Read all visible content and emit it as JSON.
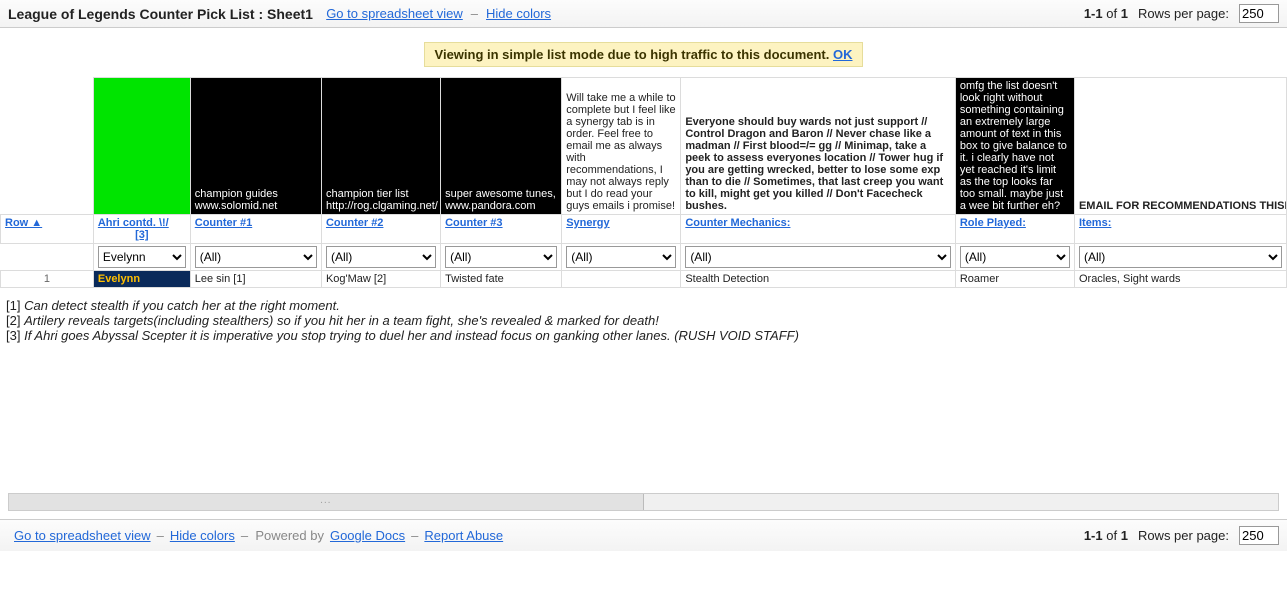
{
  "header": {
    "title": "League of Legends Counter Pick List : Sheet1",
    "link_spreadsheet": "Go to spreadsheet view",
    "dash": "–",
    "link_hidecolors": "Hide colors",
    "pageinfo_a": "1-1",
    "pageinfo_b": " of ",
    "pageinfo_c": "1",
    "rpp_label": "Rows per page:",
    "rpp_value": "250"
  },
  "notice": {
    "text": "Viewing in simple list mode due to high traffic to this document. ",
    "ok": "OK"
  },
  "top_cells": {
    "guides": "champion guides www.solomid.net",
    "tier": "champion tier list http://rog.clgaming.net/",
    "tunes": "super awesome tunes, www.pandora.com",
    "synergy_note": "Will take me a while to complete but I feel like a synergy tab is in order. Feel free to email me as always with recommendations, I may not always reply but I do read your guys emails i promise!",
    "mechanics_note": "Everyone should buy wards not just support // Control Dragon and Baron // Never chase like a madman // First blood=/= gg // Minimap, take a peek to assess everyones location // Tower hug if you are getting wrecked, better to lose some exp than to die // Sometimes, that last creep you want to kill, might get you killed // Don't Facecheck bushes.",
    "role_note": "omfg the list doesn't look right without something containing an extremely large amount of text in this box to give balance to it. i clearly have not yet reached it's limit as the top looks far too small. maybe just a wee bit further eh?",
    "email_note": "EMAIL FOR RECOMMENDATIONS THISISMY"
  },
  "columns": {
    "row": "Row ▲",
    "ahri": "Ahri contd. \\!/",
    "ahri_ref": "[3]",
    "c1": "Counter #1",
    "c2": "Counter #2",
    "c3": "Counter #3",
    "syn": "Synergy",
    "mech": "Counter Mechanics:",
    "role": "Role Played:",
    "items": "Items:"
  },
  "filters": {
    "champ": "Evelynn",
    "all": "(All)"
  },
  "row1": {
    "num": "1",
    "champ": "Evelynn",
    "c1": "Lee sin  [1]",
    "c2": "Kog'Maw  [2]",
    "c3": "Twisted fate",
    "syn": "",
    "mech": "Stealth Detection",
    "role": "Roamer",
    "items": "Oracles, Sight wards"
  },
  "footnotes": {
    "f1n": "[1] ",
    "f1": "Can detect stealth if you catch her at the right moment.",
    "f2n": "[2] ",
    "f2": "Artilery reveals targets(including stealthers) so if you hit her in a team fight, she's revealed & marked for death!",
    "f3n": "[3] ",
    "f3": "If Ahri goes Abyssal Scepter it is imperative you stop trying to duel her and instead focus on ganking other lanes. (RUSH VOID STAFF)"
  },
  "footer": {
    "link_spreadsheet": "Go to spreadsheet view",
    "link_hidecolors": "Hide colors",
    "powered": "Powered by ",
    "gdocs": "Google Docs",
    "report": "Report Abuse"
  }
}
